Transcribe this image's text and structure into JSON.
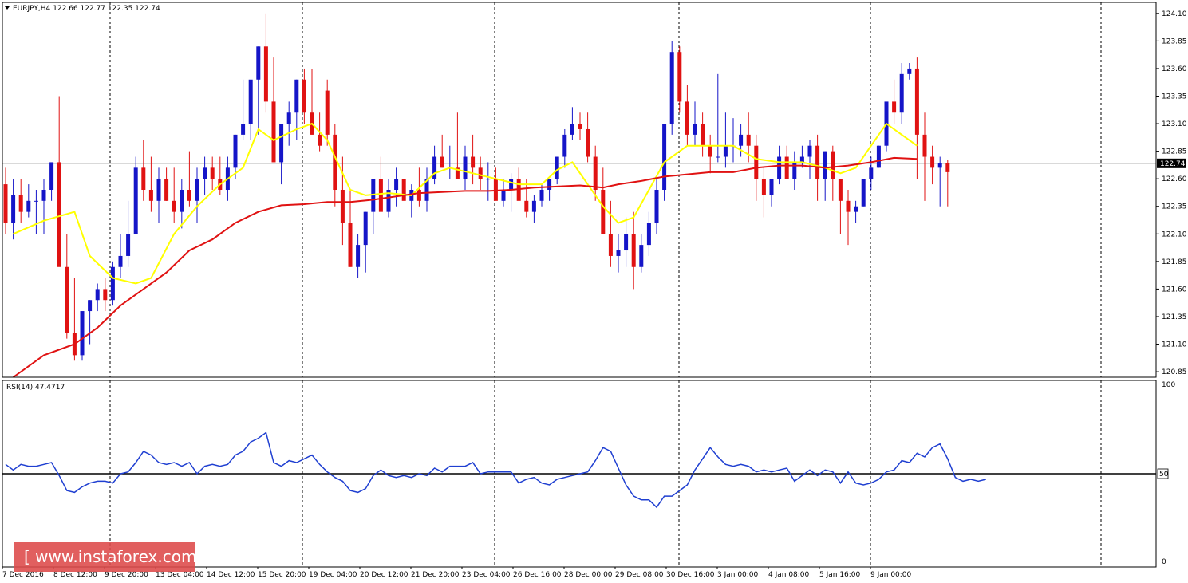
{
  "header": {
    "symbol_line": "EURJPY,H4  122.66 122.77 122.35 122.74",
    "indicator_line": "RSI(14) 47.4717"
  },
  "logo": {
    "text": "[  www.instaforex.com ]"
  },
  "colors": {
    "bull": "#1515c8",
    "bear": "#e01212",
    "ma_fast": "#ffff00",
    "ma_slow": "#e01212",
    "rsi": "#1f3fd1",
    "grid": "#000000",
    "price_tag_bg": "#000000",
    "price_tag_text": "#ffffff"
  },
  "chart_data": [
    {
      "type": "candlestick",
      "title": "EURJPY,H4",
      "x_labels": [
        "7 Dec 2016",
        "8 Dec 12:00",
        "9 Dec 20:00",
        "13 Dec 04:00",
        "14 Dec 12:00",
        "15 Dec 20:00",
        "19 Dec 04:00",
        "20 Dec 12:00",
        "21 Dec 20:00",
        "23 Dec 04:00",
        "26 Dec 16:00",
        "28 Dec 00:00",
        "29 Dec 08:00",
        "30 Dec 16:00",
        "3 Jan 00:00",
        "4 Jan 08:00",
        "5 Jan 16:00",
        "9 Jan 00:00"
      ],
      "y_ticks": [
        "124.10",
        "123.85",
        "123.60",
        "123.35",
        "123.10",
        "122.85",
        "122.60",
        "122.35",
        "122.10",
        "121.85",
        "121.60",
        "121.35",
        "121.10",
        "120.85"
      ],
      "ylim": [
        120.8,
        124.2
      ],
      "current_price": "122.74",
      "series": [
        {
          "name": "EURJPY,H4",
          "kind": "ohlc",
          "open": [
            122.55,
            122.2,
            122.45,
            122.3,
            122.4,
            122.4,
            122.5,
            122.75,
            121.8,
            121.2,
            121.0,
            121.4,
            121.5,
            121.6,
            121.5,
            121.8,
            121.9,
            122.1,
            122.7,
            122.5,
            122.4,
            122.6,
            122.4,
            122.3,
            122.5,
            122.4,
            122.6,
            122.7,
            122.6,
            122.5,
            122.7,
            123.0,
            123.1,
            123.5,
            123.8,
            123.3,
            122.75,
            123.1,
            123.2,
            123.5,
            123.2,
            123.0,
            123.4,
            123.0,
            122.5,
            122.2,
            121.8,
            122.0,
            122.3,
            122.6,
            122.3,
            122.5,
            122.6,
            122.4,
            122.5,
            122.4,
            122.6,
            122.8,
            122.7,
            122.7,
            122.6,
            122.8,
            122.7,
            122.6,
            122.6,
            122.4,
            122.5,
            122.6,
            122.4,
            122.3,
            122.4,
            122.5,
            122.6,
            122.8,
            123.0,
            123.1,
            123.05,
            122.8,
            122.5,
            122.1,
            121.9,
            121.95,
            122.1,
            121.8,
            122.0,
            122.2,
            122.5,
            123.1,
            123.75,
            123.3,
            123.0,
            123.1,
            122.9,
            122.8,
            122.8,
            122.9,
            122.9,
            123.0,
            122.9,
            122.6,
            122.45,
            122.6,
            122.8,
            122.6,
            122.75,
            122.8,
            122.9,
            122.6,
            122.85,
            122.6,
            122.4,
            122.3,
            122.35,
            122.6,
            122.7,
            122.9,
            123.3,
            123.2,
            123.55,
            123.6,
            123.0,
            122.8,
            122.7,
            122.74
          ],
          "high": [
            122.7,
            122.6,
            122.6,
            122.55,
            122.5,
            122.6,
            122.7,
            123.35,
            122.1,
            121.7,
            121.3,
            121.5,
            121.65,
            121.7,
            121.85,
            122.1,
            122.4,
            122.8,
            122.95,
            122.8,
            122.7,
            122.7,
            122.7,
            122.6,
            122.85,
            122.7,
            122.8,
            122.8,
            122.8,
            122.8,
            123.0,
            123.5,
            123.3,
            123.8,
            124.1,
            123.7,
            123.1,
            123.3,
            123.5,
            123.6,
            123.6,
            123.2,
            123.5,
            123.1,
            122.8,
            122.5,
            122.1,
            122.3,
            122.5,
            122.8,
            122.6,
            122.7,
            122.6,
            122.55,
            122.7,
            122.7,
            122.9,
            123.0,
            122.9,
            123.2,
            122.9,
            123.0,
            122.8,
            122.75,
            122.7,
            122.6,
            122.65,
            122.7,
            122.6,
            122.45,
            122.55,
            122.6,
            122.8,
            123.05,
            123.25,
            123.2,
            123.2,
            122.9,
            122.7,
            122.4,
            122.1,
            122.25,
            122.3,
            122.1,
            122.3,
            122.6,
            123.0,
            123.85,
            123.8,
            123.45,
            123.3,
            123.2,
            123.0,
            123.55,
            123.2,
            123.15,
            123.1,
            123.2,
            123.0,
            122.7,
            122.6,
            122.9,
            122.9,
            122.85,
            122.9,
            122.95,
            123.0,
            122.85,
            122.9,
            122.6,
            122.5,
            122.4,
            122.6,
            122.8,
            122.9,
            123.2,
            123.5,
            123.65,
            123.65,
            123.7,
            123.2,
            122.9,
            122.8,
            122.77
          ],
          "low": [
            122.1,
            122.05,
            122.2,
            122.25,
            122.1,
            122.1,
            122.4,
            122.45,
            121.15,
            120.95,
            120.95,
            121.1,
            121.4,
            121.4,
            121.45,
            121.7,
            121.8,
            122.1,
            122.4,
            122.3,
            122.2,
            122.4,
            122.2,
            122.15,
            122.35,
            122.2,
            122.45,
            122.5,
            122.45,
            122.4,
            122.6,
            122.95,
            122.95,
            123.0,
            123.2,
            122.8,
            122.55,
            122.9,
            122.95,
            123.1,
            123.0,
            122.85,
            122.9,
            122.35,
            122.0,
            121.8,
            121.7,
            121.75,
            122.1,
            122.4,
            122.25,
            122.35,
            122.45,
            122.25,
            122.35,
            122.3,
            122.55,
            122.7,
            122.6,
            122.6,
            122.5,
            122.55,
            122.5,
            122.4,
            122.45,
            122.35,
            122.3,
            122.45,
            122.25,
            122.2,
            122.35,
            122.4,
            122.55,
            122.7,
            122.95,
            122.95,
            122.75,
            122.4,
            122.1,
            121.8,
            121.75,
            121.8,
            121.6,
            121.75,
            121.9,
            122.1,
            122.4,
            123.0,
            123.2,
            122.9,
            122.9,
            122.8,
            122.65,
            122.75,
            122.7,
            122.75,
            122.8,
            122.75,
            122.4,
            122.25,
            122.35,
            122.55,
            122.6,
            122.5,
            122.7,
            122.6,
            122.4,
            122.4,
            122.4,
            122.1,
            122.0,
            122.2,
            122.35,
            122.5,
            122.7,
            122.85,
            123.1,
            123.1,
            123.5,
            122.6,
            122.4,
            122.55,
            122.35,
            122.35
          ],
          "close": [
            122.2,
            122.45,
            122.3,
            122.4,
            122.4,
            122.5,
            122.75,
            121.8,
            121.2,
            121.0,
            121.4,
            121.5,
            121.6,
            121.5,
            121.8,
            121.9,
            122.1,
            122.7,
            122.5,
            122.4,
            122.6,
            122.4,
            122.3,
            122.5,
            122.4,
            122.6,
            122.7,
            122.6,
            122.5,
            122.7,
            123.0,
            123.1,
            123.5,
            123.8,
            123.3,
            122.75,
            123.1,
            123.2,
            123.5,
            123.2,
            123.0,
            122.9,
            123.0,
            122.5,
            122.2,
            121.8,
            122.0,
            122.3,
            122.6,
            122.3,
            122.5,
            122.6,
            122.4,
            122.5,
            122.4,
            122.6,
            122.8,
            122.7,
            122.7,
            122.6,
            122.8,
            122.7,
            122.6,
            122.6,
            122.4,
            122.5,
            122.6,
            122.4,
            122.3,
            122.4,
            122.5,
            122.6,
            122.8,
            123.0,
            123.1,
            123.05,
            122.8,
            122.5,
            122.1,
            121.9,
            121.95,
            122.1,
            121.8,
            122.0,
            122.2,
            122.5,
            123.1,
            123.75,
            123.3,
            123.0,
            123.1,
            122.9,
            122.8,
            122.8,
            122.9,
            122.9,
            123.0,
            122.9,
            122.6,
            122.45,
            122.6,
            122.8,
            122.6,
            122.75,
            122.8,
            122.9,
            122.6,
            122.85,
            122.6,
            122.4,
            122.3,
            122.35,
            122.6,
            122.7,
            122.9,
            123.3,
            123.2,
            123.55,
            123.6,
            123.0,
            122.8,
            122.7,
            122.74,
            122.66
          ]
        },
        {
          "name": "",
          "kind": "line",
          "color": "#ffff00",
          "points": [
            [
              1,
              122.1
            ],
            [
              5,
              122.22
            ],
            [
              9,
              122.3
            ],
            [
              11,
              121.9
            ],
            [
              14,
              121.7
            ],
            [
              17,
              121.65
            ],
            [
              19,
              121.7
            ],
            [
              22,
              122.1
            ],
            [
              25,
              122.35
            ],
            [
              28,
              122.55
            ],
            [
              31,
              122.7
            ],
            [
              33,
              123.05
            ],
            [
              35,
              122.95
            ],
            [
              38,
              123.05
            ],
            [
              40,
              123.1
            ],
            [
              42,
              122.95
            ],
            [
              45,
              122.5
            ],
            [
              47,
              122.45
            ],
            [
              50,
              122.47
            ],
            [
              53,
              122.45
            ],
            [
              56,
              122.65
            ],
            [
              58,
              122.7
            ],
            [
              61,
              122.65
            ],
            [
              64,
              122.6
            ],
            [
              67,
              122.55
            ],
            [
              70,
              122.55
            ],
            [
              72,
              122.68
            ],
            [
              74,
              122.75
            ],
            [
              76,
              122.55
            ],
            [
              78,
              122.35
            ],
            [
              80,
              122.2
            ],
            [
              82,
              122.25
            ],
            [
              84,
              122.5
            ],
            [
              86,
              122.75
            ],
            [
              89,
              122.9
            ],
            [
              92,
              122.9
            ],
            [
              95,
              122.9
            ],
            [
              98,
              122.78
            ],
            [
              101,
              122.75
            ],
            [
              104,
              122.75
            ],
            [
              107,
              122.7
            ],
            [
              109,
              122.65
            ],
            [
              111,
              122.7
            ],
            [
              113,
              122.9
            ],
            [
              115,
              123.1
            ],
            [
              117,
              123.0
            ],
            [
              119,
              122.9
            ]
          ]
        },
        {
          "name": "",
          "kind": "line",
          "color": "#e01212",
          "points": [
            [
              1,
              120.8
            ],
            [
              5,
              121.0
            ],
            [
              9,
              121.1
            ],
            [
              12,
              121.25
            ],
            [
              15,
              121.45
            ],
            [
              18,
              121.6
            ],
            [
              21,
              121.75
            ],
            [
              24,
              121.95
            ],
            [
              27,
              122.05
            ],
            [
              30,
              122.2
            ],
            [
              33,
              122.3
            ],
            [
              36,
              122.36
            ],
            [
              39,
              122.37
            ],
            [
              42,
              122.39
            ],
            [
              45,
              122.39
            ],
            [
              48,
              122.41
            ],
            [
              51,
              122.44
            ],
            [
              54,
              122.47
            ],
            [
              57,
              122.48
            ],
            [
              60,
              122.49
            ],
            [
              63,
              122.49
            ],
            [
              66,
              122.5
            ],
            [
              69,
              122.52
            ],
            [
              72,
              122.53
            ],
            [
              75,
              122.54
            ],
            [
              78,
              122.52
            ],
            [
              80,
              122.55
            ],
            [
              83,
              122.58
            ],
            [
              86,
              122.62
            ],
            [
              89,
              122.64
            ],
            [
              92,
              122.66
            ],
            [
              95,
              122.66
            ],
            [
              98,
              122.7
            ],
            [
              101,
              122.72
            ],
            [
              104,
              122.72
            ],
            [
              107,
              122.7
            ],
            [
              110,
              122.72
            ],
            [
              113,
              122.75
            ],
            [
              116,
              122.79
            ],
            [
              119,
              122.78
            ]
          ]
        }
      ]
    },
    {
      "type": "line",
      "title": "RSI(14) 47.4717",
      "y_ticks": [
        "100",
        "50",
        "0"
      ],
      "ylim": [
        0,
        100
      ],
      "reference_level": 50,
      "reference_label": "50",
      "series": [
        {
          "name": "RSI(14)",
          "values": [
            55,
            52,
            55,
            54,
            54,
            55,
            56,
            49,
            41,
            40,
            43,
            45,
            46,
            46,
            45,
            50,
            51,
            56,
            62,
            60,
            56,
            55,
            56,
            54,
            56,
            50,
            54,
            55,
            54,
            55,
            60,
            62,
            67,
            69,
            72,
            56,
            54,
            57,
            56,
            58,
            60,
            55,
            51,
            48,
            46,
            41,
            40,
            42,
            49,
            52,
            49,
            48,
            49,
            48,
            50,
            49,
            53,
            51,
            54,
            54,
            54,
            56,
            50,
            51,
            51,
            51,
            51,
            45,
            47,
            48,
            45,
            44,
            47,
            48,
            49,
            50,
            51,
            57,
            64,
            62,
            53,
            44,
            38,
            36,
            36,
            32,
            38,
            38,
            41,
            44,
            52,
            58,
            64,
            59,
            55,
            54,
            55,
            54,
            51,
            52,
            51,
            52,
            53,
            46,
            49,
            52,
            49,
            52,
            51,
            45,
            51,
            45,
            44,
            45,
            47,
            51,
            52,
            57,
            56,
            61,
            59,
            64,
            66,
            58,
            48,
            46,
            47,
            46,
            47
          ]
        }
      ]
    }
  ]
}
